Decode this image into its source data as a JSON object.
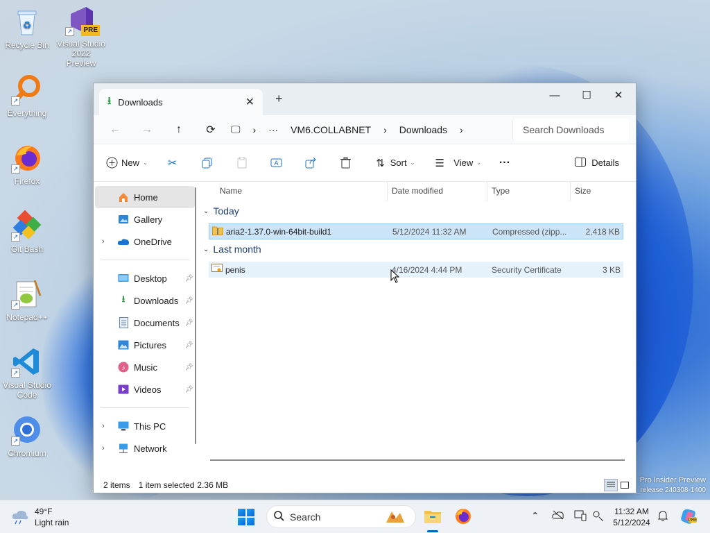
{
  "desktop": {
    "icons": [
      {
        "label": "Recycle Bin"
      },
      {
        "label": "Visual Studio 2022 Preview",
        "badge": "PRE"
      },
      {
        "label": "Everything"
      },
      {
        "label": "Firefox"
      },
      {
        "label": "Git Bash"
      },
      {
        "label": "Notepad++"
      },
      {
        "label": "Visual Studio Code"
      },
      {
        "label": "Chromium"
      }
    ],
    "watermark": {
      "line1": "Pro Insider Preview",
      "line2": "Evaluation copy. Build 26080.ge_release.240308-1400"
    }
  },
  "window": {
    "tab_title": "Downloads",
    "new_tab": "+",
    "controls": {
      "minimize": "—",
      "maximize": "☐",
      "close": "✕"
    },
    "breadcrumb": [
      "VM6.COLLABNET",
      "Downloads"
    ],
    "breadcrumb_more": "···",
    "search_placeholder": "Search Downloads",
    "toolbar": {
      "new_label": "New",
      "sort_label": "Sort",
      "view_label": "View",
      "more_label": "···",
      "details_label": "Details"
    },
    "nav": {
      "home": "Home",
      "gallery": "Gallery",
      "onedrive": "OneDrive",
      "quick": [
        {
          "label": "Desktop"
        },
        {
          "label": "Downloads"
        },
        {
          "label": "Documents"
        },
        {
          "label": "Pictures"
        },
        {
          "label": "Music"
        },
        {
          "label": "Videos"
        }
      ],
      "this_pc": "This PC",
      "network": "Network"
    },
    "columns": {
      "name": "Name",
      "date": "Date modified",
      "type": "Type",
      "size": "Size"
    },
    "groups": [
      {
        "title": "Today",
        "files": [
          {
            "name": "aria2-1.37.0-win-64bit-build1",
            "date": "5/12/2024 11:32 AM",
            "type": "Compressed (zipp...",
            "size": "2,418 KB",
            "selected": true
          }
        ]
      },
      {
        "title": "Last month",
        "files": [
          {
            "name": "penis",
            "date": "4/16/2024 4:44 PM",
            "type": "Security Certificate",
            "size": "3 KB",
            "selected": false
          }
        ]
      }
    ],
    "status": {
      "items": "2 items",
      "selected": "1 item selected",
      "selected_size": "2.36 MB"
    }
  },
  "taskbar": {
    "weather": {
      "temp": "49°F",
      "condition": "Light rain"
    },
    "search_label": "Search",
    "clock": {
      "time": "11:32 AM",
      "date": "5/12/2024"
    }
  },
  "colors": {
    "accent": "#0067c0",
    "selection": "#cce4f7",
    "folder": "#f2c14e"
  }
}
